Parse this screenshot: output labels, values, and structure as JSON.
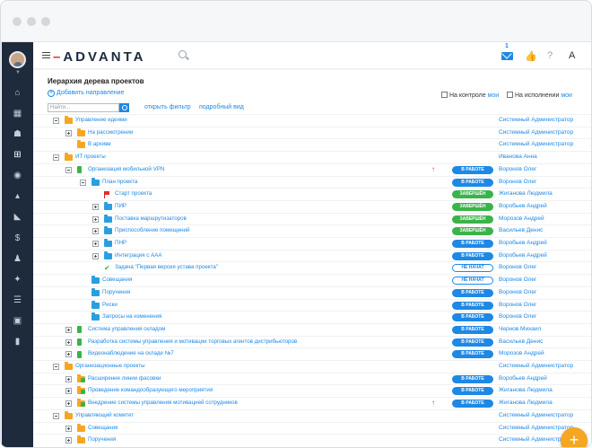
{
  "header": {
    "logo_prefix": "",
    "logo_main": "ADVANTA",
    "mail_count": "1"
  },
  "page": {
    "title": "Иерархия дерева проектов",
    "add_direction": "Добавить направление",
    "on_control": "На контроле",
    "on_execution": "На исполнении",
    "my": "мои",
    "find_placeholder": "Найти...",
    "open_filter": "открыть фильтр",
    "detailed_view": "подробный вид"
  },
  "colors": {
    "sidebar": "#1d2b3d",
    "accent_blue": "#1e88e5",
    "done_green": "#3bb34a",
    "folder_orange": "#f5a623",
    "priority_red": "#e52e2e"
  },
  "sidebar": {
    "icons": [
      "home-icon",
      "calendar-icon",
      "users-icon",
      "hierarchy-icon",
      "target-icon",
      "chart-icon",
      "reports-icon",
      "dollar-icon",
      "run-icon",
      "sparkle-icon",
      "checklist-icon",
      "window-icon",
      "bookmark-icon"
    ]
  },
  "status_labels": {
    "work": "В РАБОТЕ",
    "done": "ЗАВЕРШЁН",
    "new": "НЕ НАЧАТ"
  },
  "tree": [
    {
      "level": 0,
      "toggle": "minus",
      "icon": "folder-orange",
      "label": "Управление идеями",
      "status": "",
      "prio": false,
      "person": "Системный Администратор"
    },
    {
      "level": 1,
      "toggle": "plus",
      "icon": "folder-orange",
      "label": "На рассмотрении",
      "status": "",
      "prio": false,
      "person": "Системный Администратор"
    },
    {
      "level": 1,
      "toggle": "none",
      "icon": "folder-orange",
      "label": "В архиве",
      "status": "",
      "prio": false,
      "person": "Системный Администратор"
    },
    {
      "level": 0,
      "toggle": "minus",
      "icon": "folder-orange",
      "label": "ИТ проекты",
      "status": "",
      "prio": false,
      "person": "Иванова Анна"
    },
    {
      "level": 1,
      "toggle": "minus",
      "icon": "project-green",
      "label": "Организация мобильной VPN",
      "status": "work",
      "prio": true,
      "person": "Воронов Олег"
    },
    {
      "level": 2,
      "toggle": "minus",
      "icon": "folder-blue",
      "label": "План проекта",
      "status": "work",
      "prio": false,
      "person": "Воронов Олег"
    },
    {
      "level": 3,
      "toggle": "none",
      "icon": "flag-red",
      "label": "Старт проекта",
      "status": "done",
      "prio": false,
      "person": "Жиганова Людмила"
    },
    {
      "level": 3,
      "toggle": "plus",
      "icon": "folder-blue",
      "label": "ПИР",
      "status": "done",
      "prio": false,
      "person": "Воробьев Андрей"
    },
    {
      "level": 3,
      "toggle": "plus",
      "icon": "folder-blue",
      "label": "Поставка маршрутизаторов",
      "status": "done",
      "prio": false,
      "person": "Морозов Андрей"
    },
    {
      "level": 3,
      "toggle": "plus",
      "icon": "folder-blue",
      "label": "Приспособление помещений",
      "status": "done",
      "prio": false,
      "person": "Васильев Денис"
    },
    {
      "level": 3,
      "toggle": "plus",
      "icon": "folder-blue",
      "label": "ПНР",
      "status": "work",
      "prio": false,
      "person": "Воробьев Андрей"
    },
    {
      "level": 3,
      "toggle": "plus",
      "icon": "folder-blue",
      "label": "Интеграция с ААА",
      "status": "work",
      "prio": false,
      "person": "Воробьев Андрей"
    },
    {
      "level": 3,
      "toggle": "none",
      "icon": "check-green",
      "label": "Задача \"Первая версия устава проекта\"",
      "status": "new",
      "prio": false,
      "person": "Воронов Олег"
    },
    {
      "level": 2,
      "toggle": "none",
      "icon": "folder-blue",
      "label": "Совещания",
      "status": "new",
      "prio": false,
      "person": "Воронов Олег"
    },
    {
      "level": 2,
      "toggle": "none",
      "icon": "folder-blue",
      "label": "Поручения",
      "status": "work",
      "prio": false,
      "person": "Воронов Олег"
    },
    {
      "level": 2,
      "toggle": "none",
      "icon": "folder-blue",
      "label": "Риски",
      "status": "work",
      "prio": false,
      "person": "Воронов Олег"
    },
    {
      "level": 2,
      "toggle": "none",
      "icon": "folder-blue",
      "label": "Запросы на изменения",
      "status": "work",
      "prio": false,
      "person": "Воронов Олег"
    },
    {
      "level": 1,
      "toggle": "plus",
      "icon": "project-green",
      "label": "Система управления складом",
      "status": "work",
      "prio": false,
      "person": "Чернов Михаил"
    },
    {
      "level": 1,
      "toggle": "plus",
      "icon": "project-green",
      "label": "Разработка системы управления и мотивации торговых агентов дистрибьюторов",
      "status": "work",
      "prio": false,
      "person": "Васильев Денис"
    },
    {
      "level": 1,
      "toggle": "plus",
      "icon": "project-green",
      "label": "Видеонаблюдение на складе №7",
      "status": "work",
      "prio": false,
      "person": "Морозов Андрей"
    },
    {
      "level": 0,
      "toggle": "minus",
      "icon": "folder-orange",
      "label": "Организационные проекты",
      "status": "",
      "prio": false,
      "person": "Системный Администратор"
    },
    {
      "level": 1,
      "toggle": "plus",
      "icon": "folder-multi",
      "label": "Расширение линии фасовки",
      "status": "work",
      "prio": false,
      "person": "Воробьев Андрей"
    },
    {
      "level": 1,
      "toggle": "plus",
      "icon": "folder-multi",
      "label": "Проведение командообразующего мероприятия",
      "status": "work",
      "prio": false,
      "person": "Жиганова Людмила"
    },
    {
      "level": 1,
      "toggle": "plus",
      "icon": "folder-multi",
      "label": "Внедрение системы управления мотивацией сотрудников",
      "status": "work",
      "prio": true,
      "person": "Жиганова Людмила"
    },
    {
      "level": 0,
      "toggle": "minus",
      "icon": "folder-orange",
      "label": "Управляющий комитет",
      "status": "",
      "prio": false,
      "person": "Системный Администратор"
    },
    {
      "level": 1,
      "toggle": "plus",
      "icon": "folder-orange",
      "label": "Совещания",
      "status": "",
      "prio": false,
      "person": "Системный Администратор"
    },
    {
      "level": 1,
      "toggle": "plus",
      "icon": "folder-orange",
      "label": "Поручения",
      "status": "",
      "prio": false,
      "person": "Системный Администратор"
    }
  ]
}
